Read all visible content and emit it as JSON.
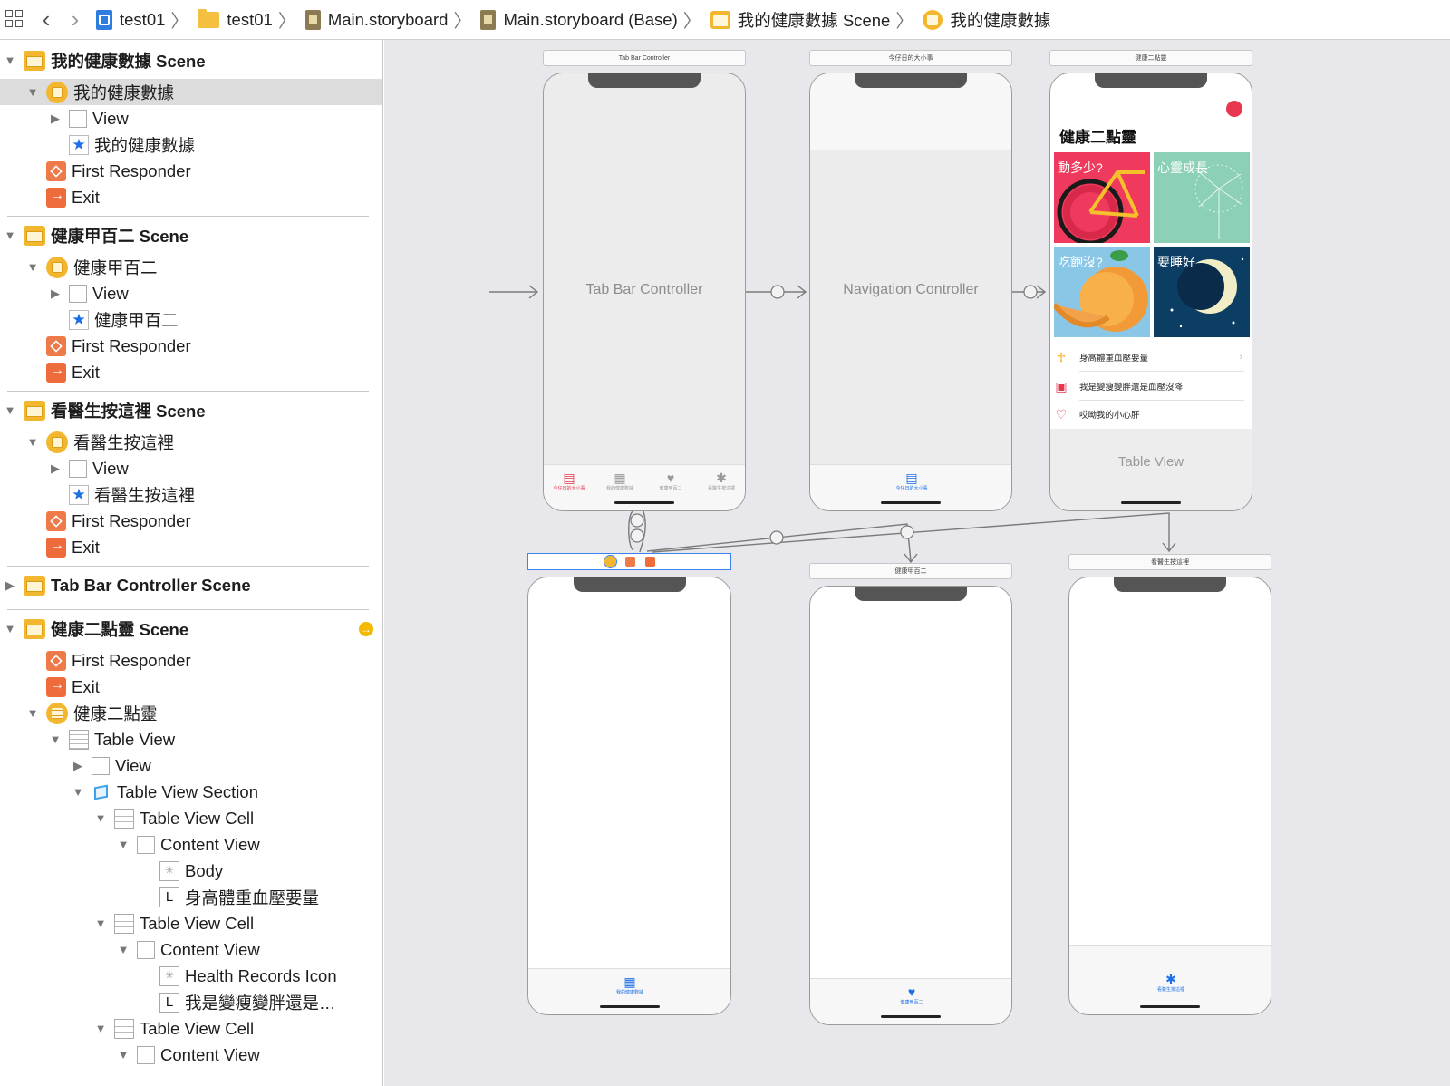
{
  "jumpbar": {
    "crumbs": [
      "test01",
      "test01",
      "Main.storyboard",
      "Main.storyboard (Base)",
      "我的健康數據 Scene",
      "我的健康數據"
    ]
  },
  "outline": {
    "rows": [
      {
        "label": "我的健康數據 Scene",
        "icon": "scene-icon",
        "disclosure": "expanded"
      },
      {
        "label": "我的健康數據",
        "icon": "view-controller-icon",
        "disclosure": "expanded",
        "selected": true
      },
      {
        "label": "View",
        "icon": "view-icon",
        "disclosure": "collapsed"
      },
      {
        "label": "我的健康數據",
        "icon": "tab-bar-item-icon"
      },
      {
        "label": "First Responder",
        "icon": "first-responder-icon"
      },
      {
        "label": "Exit",
        "icon": "exit-icon"
      },
      {
        "label": "健康甲百二 Scene",
        "icon": "scene-icon",
        "disclosure": "expanded"
      },
      {
        "label": "健康甲百二",
        "icon": "view-controller-icon",
        "disclosure": "expanded"
      },
      {
        "label": "View",
        "icon": "view-icon",
        "disclosure": "collapsed"
      },
      {
        "label": "健康甲百二",
        "icon": "tab-bar-item-icon"
      },
      {
        "label": "First Responder",
        "icon": "first-responder-icon"
      },
      {
        "label": "Exit",
        "icon": "exit-icon"
      },
      {
        "label": "看醫生按這裡 Scene",
        "icon": "scene-icon",
        "disclosure": "expanded"
      },
      {
        "label": "看醫生按這裡",
        "icon": "view-controller-icon",
        "disclosure": "expanded"
      },
      {
        "label": "View",
        "icon": "view-icon",
        "disclosure": "collapsed"
      },
      {
        "label": "看醫生按這裡",
        "icon": "tab-bar-item-icon"
      },
      {
        "label": "First Responder",
        "icon": "first-responder-icon"
      },
      {
        "label": "Exit",
        "icon": "exit-icon"
      },
      {
        "label": "Tab Bar Controller Scene",
        "icon": "scene-icon",
        "disclosure": "collapsed"
      },
      {
        "label": "健康二點靈 Scene",
        "icon": "scene-icon",
        "disclosure": "expanded",
        "warning": true
      },
      {
        "label": "First Responder",
        "icon": "first-responder-icon"
      },
      {
        "label": "Exit",
        "icon": "exit-icon"
      },
      {
        "label": "健康二點靈",
        "icon": "table-view-controller-icon",
        "disclosure": "expanded"
      },
      {
        "label": "Table View",
        "icon": "table-view-icon",
        "disclosure": "expanded"
      },
      {
        "label": "View",
        "icon": "view-icon",
        "disclosure": "collapsed"
      },
      {
        "label": "Table View Section",
        "icon": "table-section-icon",
        "disclosure": "expanded"
      },
      {
        "label": "Table View Cell",
        "icon": "table-cell-icon",
        "disclosure": "expanded"
      },
      {
        "label": "Content View",
        "icon": "view-icon",
        "disclosure": "expanded"
      },
      {
        "label": "Body",
        "icon": "image-view-icon"
      },
      {
        "label": "身高體重血壓要量",
        "icon": "label-icon"
      },
      {
        "label": "Table View Cell",
        "icon": "table-cell-icon",
        "disclosure": "expanded"
      },
      {
        "label": "Content View",
        "icon": "view-icon",
        "disclosure": "expanded"
      },
      {
        "label": "Health Records Icon",
        "icon": "image-view-icon"
      },
      {
        "label": "我是變瘦變胖還是…",
        "icon": "label-icon"
      },
      {
        "label": "Table View Cell",
        "icon": "table-cell-icon",
        "disclosure": "expanded"
      },
      {
        "label": "Content View",
        "icon": "view-icon",
        "disclosure": "expanded"
      }
    ]
  },
  "canvas": {
    "tab_bar_controller": {
      "title": "Tab Bar Controller",
      "label": "Tab Bar Controller",
      "tabs": [
        "今仔日的大小事",
        "我的健康數據",
        "健康甲百二",
        "看醫生按這裡"
      ]
    },
    "navigation_controller": {
      "title": "今仔日的大小事",
      "label": "Navigation Controller",
      "tab": "今仔日的大小事"
    },
    "health_scene": {
      "title": "健康二點靈",
      "heading": "健康二點靈",
      "tiles": [
        "動多少?",
        "心靈成長",
        "吃飽沒?",
        "要睡好"
      ],
      "rows": [
        "身高體重血壓要量",
        "我是變瘦變胖還是血壓沒降",
        "哎呦我的小心肝"
      ],
      "table_view_label": "Table View"
    },
    "my_health_scene": {
      "tab": "我的健康數據"
    },
    "jiankang_scene": {
      "title": "健康甲百二",
      "tab": "健康甲百二"
    },
    "doctor_scene": {
      "title": "看醫生按這裡",
      "tab": "看醫生按這裡"
    }
  },
  "colors": {
    "tab_active_red": "#e8364f",
    "tab_active_blue": "#1c6fe6",
    "tile_red": "#ef3a5d",
    "tile_green": "#8cd0b5",
    "tile_blue": "#8ac6e6",
    "tile_night": "#0c3d63"
  }
}
